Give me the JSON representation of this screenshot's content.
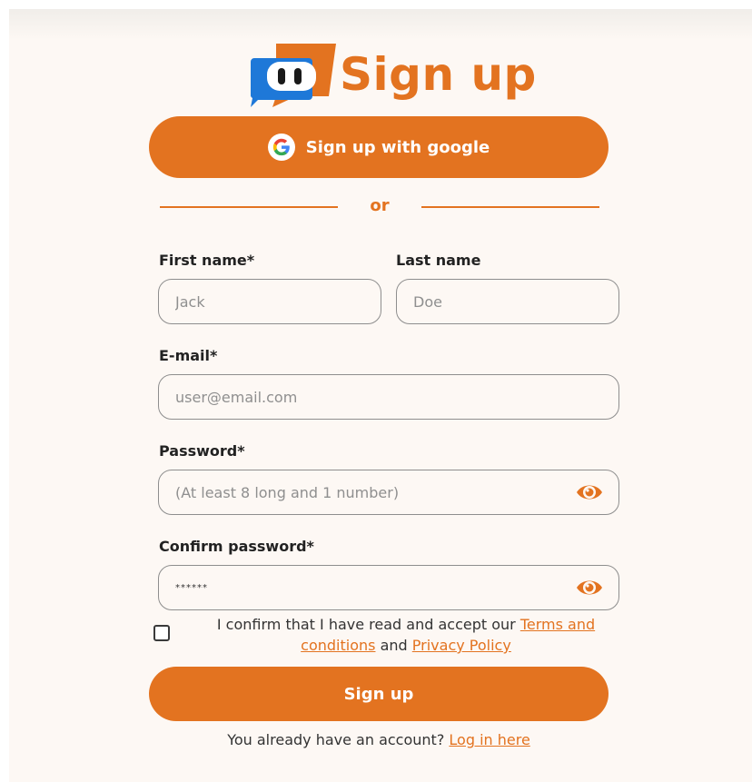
{
  "header": {
    "title": "Sign up"
  },
  "google_button": {
    "label": "Sign up with google"
  },
  "divider": {
    "text": "or"
  },
  "form": {
    "first_name": {
      "label": "First name*",
      "placeholder": "Jack"
    },
    "last_name": {
      "label": "Last name",
      "placeholder": "Doe"
    },
    "email": {
      "label": "E-mail*",
      "placeholder": "user@email.com"
    },
    "password": {
      "label": "Password*",
      "placeholder": "(At least 8 long and 1 number)"
    },
    "confirm_password": {
      "label": "Confirm password*",
      "value": "******"
    }
  },
  "consent": {
    "prefix": "I confirm that I have read and accept our",
    "terms_link": "Terms and conditions",
    "middle": "and",
    "privacy_link": "Privacy Policy"
  },
  "submit_button": {
    "label": "Sign up"
  },
  "footer": {
    "question": "You already have an account?",
    "login_link": "Log in here"
  },
  "colors": {
    "accent": "#e37320",
    "logo_blue": "#1e78d8",
    "background": "#fdf8f4"
  },
  "icons": [
    "robot-logo-icon",
    "google-g-icon",
    "eye-icon"
  ]
}
